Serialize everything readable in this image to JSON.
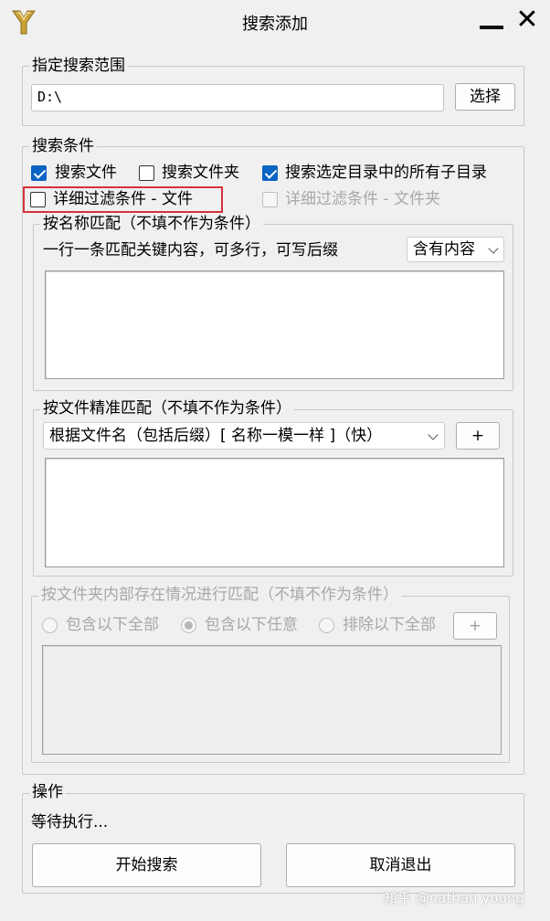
{
  "window": {
    "title": "搜索添加",
    "minimize_icon": "minimize-icon",
    "close_icon": "close-icon"
  },
  "scope": {
    "legend": "指定搜索范围",
    "path_value": "D:\\",
    "select_button": "选择"
  },
  "conditions": {
    "legend": "搜索条件",
    "checkboxes": [
      {
        "label": "搜索文件",
        "checked": true
      },
      {
        "label": "搜索文件夹",
        "checked": false
      },
      {
        "label": "搜索选定目录中的所有子目录",
        "checked": true
      },
      {
        "label": "详细过滤条件 - 文件",
        "checked": false
      },
      {
        "label": "详细过滤条件 - 文件夹",
        "checked": false,
        "disabled": true
      }
    ]
  },
  "name_match": {
    "legend": "按名称匹配（不填不作为条件）",
    "hint": "一行一条匹配关键内容，可多行，可写后缀",
    "mode_selected": "含有内容",
    "keywords": ""
  },
  "exact_match": {
    "legend": "按文件精准匹配（不填不作为条件）",
    "mode_selected": "根据文件名（包括后缀）[ 名称一模一样 ]（快）",
    "add_button": "+",
    "entries": ""
  },
  "folder_content": {
    "legend": "按文件夹内部存在情况进行匹配（不填不作为条件）",
    "options": [
      {
        "label": "包含以下全部",
        "selected": false
      },
      {
        "label": "包含以下任意",
        "selected": true
      },
      {
        "label": "排除以下全部",
        "selected": false
      }
    ],
    "add_button": "+"
  },
  "operation": {
    "legend": "操作",
    "status": "等待执行...",
    "start_button": "开始搜索",
    "cancel_button": "取消退出"
  },
  "watermark": "知乎 @nathan young",
  "colors": {
    "accent": "#0b63c5",
    "highlight": "#d6333a",
    "background": "#f0f0f0"
  }
}
